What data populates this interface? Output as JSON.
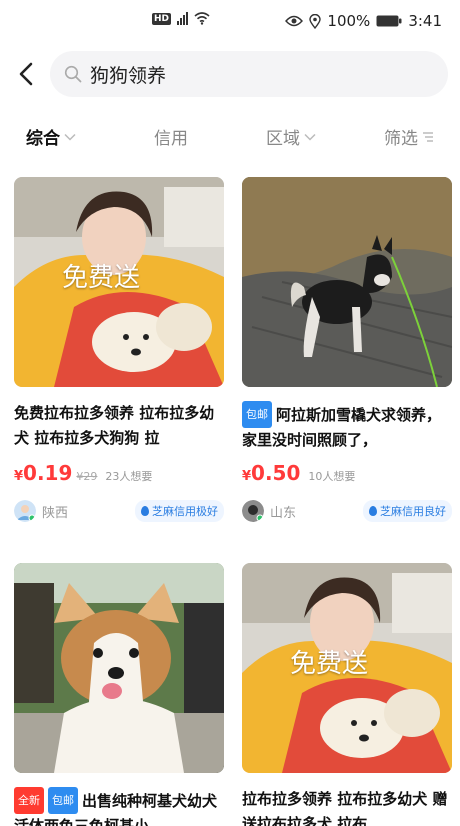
{
  "status": {
    "battery": "100%",
    "time": "3:41",
    "hd": "HD"
  },
  "search": {
    "query": "狗狗领养"
  },
  "filters": [
    {
      "label": "综合"
    },
    {
      "label": "信用"
    },
    {
      "label": "区域"
    },
    {
      "label": "筛选"
    }
  ],
  "items": [
    {
      "image_text": "免费送",
      "title": "免费拉布拉多领养 拉布拉多幼犬 拉布拉多犬狗狗 拉",
      "tags": [],
      "price_symbol": "¥",
      "price": "0.19",
      "original_price": "¥29",
      "wants": "23人想要",
      "location": "陕西",
      "credit": "芝麻信用极好"
    },
    {
      "image_text": "",
      "title": "阿拉斯加雪橇犬求领养，家里没时间照顾了，",
      "tags": [
        "包邮"
      ],
      "price_symbol": "¥",
      "price": "0.50",
      "original_price": "",
      "wants": "10人想要",
      "location": "山东",
      "credit": "芝麻信用良好"
    },
    {
      "image_text": "",
      "title": "出售纯种柯基犬幼犬活体两色三色柯基小",
      "tags": [
        "全新",
        "包邮"
      ]
    },
    {
      "image_text": "免费送",
      "title": "拉布拉多领养 拉布拉多幼犬 赠送拉布拉多犬 拉布",
      "tags": []
    }
  ]
}
